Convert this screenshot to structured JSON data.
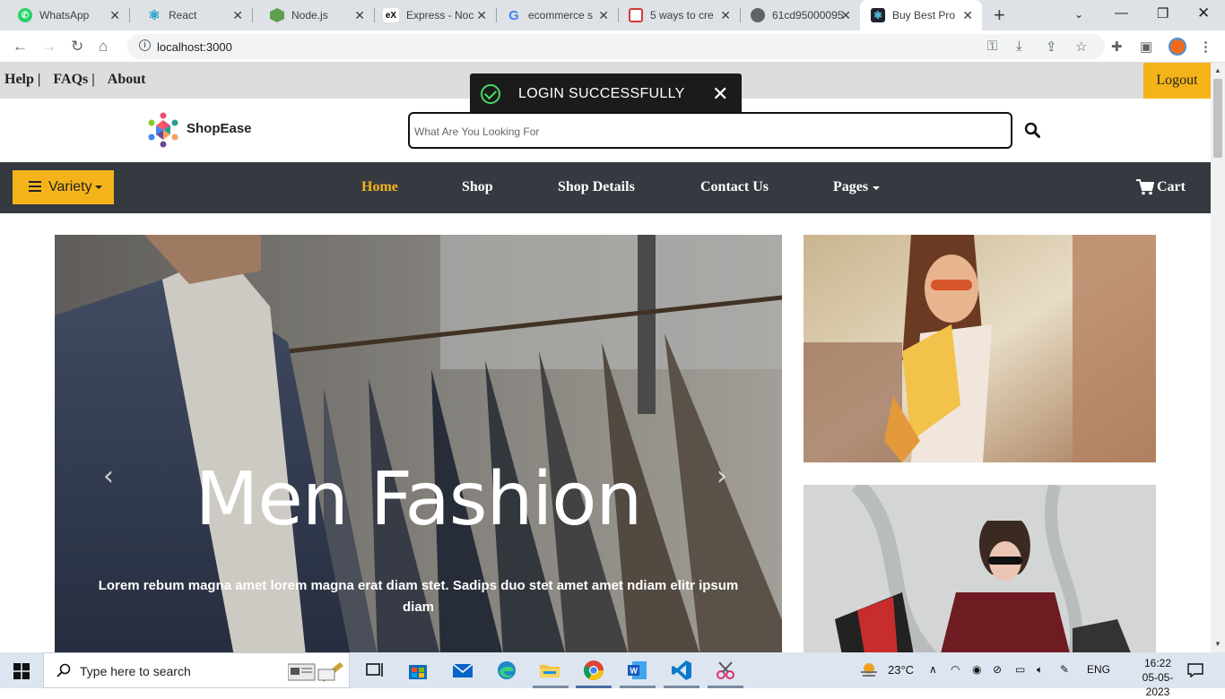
{
  "browser": {
    "tabs": [
      {
        "title": "WhatsApp",
        "icon": "whatsapp-icon",
        "color": "#25d366"
      },
      {
        "title": "React",
        "icon": "react-icon",
        "color": "#149eca"
      },
      {
        "title": "Node.js",
        "icon": "nodejs-icon",
        "color": "#5fa04e"
      },
      {
        "title": "Express - Noc",
        "icon": "express-icon",
        "color": "#000000"
      },
      {
        "title": "ecommerce s",
        "icon": "google-icon",
        "color": "#4285f4"
      },
      {
        "title": "5 ways to cre",
        "icon": "box-icon",
        "color": "#d03a3a"
      },
      {
        "title": "61cd95000095",
        "icon": "globe-icon",
        "color": "#5f6368"
      },
      {
        "title": "Buy Best Pro",
        "icon": "react-icon",
        "color": "#20232a",
        "active": true
      }
    ],
    "url": "localhost:3000"
  },
  "topbar": {
    "links": [
      "Help |",
      "FAQs |",
      "About"
    ],
    "logout_label": "Logout"
  },
  "toast": {
    "message": "LOGIN SUCCESSFULLY"
  },
  "header": {
    "brand": "ShopEase",
    "search_placeholder": "What Are You Looking For"
  },
  "nav": {
    "variety_label": "Variety",
    "links": [
      "Home",
      "Shop",
      "Shop Details",
      "Contact Us",
      "Pages"
    ],
    "active": "Home",
    "cart_label": "Cart"
  },
  "hero": {
    "title": "Men Fashion",
    "text": "Lorem rebum magna amet lorem magna erat diam stet. Sadips duo stet amet amet ndiam elitr ipsum diam"
  },
  "taskbar": {
    "search_placeholder": "Type here to search",
    "weather": "23°C",
    "language": "ENG",
    "time": "16:22",
    "date": "05-05-2023"
  },
  "colors": {
    "accent": "#f5b31a",
    "navbar": "#343a40",
    "toast_bg": "#1b1b1b",
    "success": "#4cd964"
  }
}
